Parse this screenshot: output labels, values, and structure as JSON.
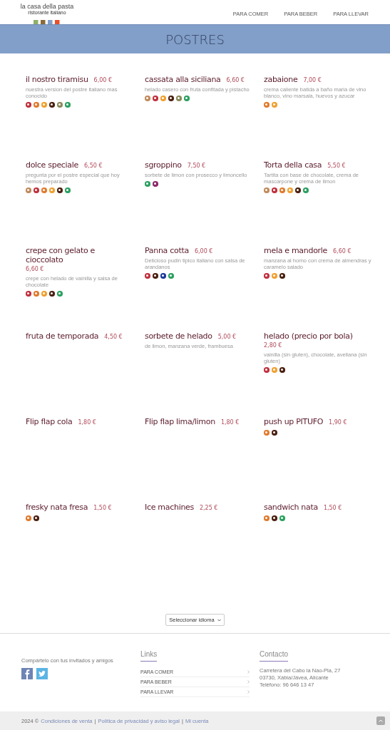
{
  "header": {
    "logo_title": "la casa della pasta",
    "logo_subtitle": "ristorante italiano",
    "nav": [
      {
        "label": "PARA COMER"
      },
      {
        "label": "PARA BEBER"
      },
      {
        "label": "PARA LLEVAR"
      }
    ]
  },
  "banner": {
    "title": "POSTRES"
  },
  "menu_items": [
    {
      "name": "il nostro tiramisu",
      "price": "6,00 €",
      "description": "nuestra version del postre italiano mas conocido",
      "allergens": [
        {
          "color": "#c0313e"
        },
        {
          "color": "#e07a2e"
        },
        {
          "color": "#f0a030"
        },
        {
          "color": "#4a2010"
        },
        {
          "color": "#8a8a5a"
        },
        {
          "color": "#2aa060"
        }
      ]
    },
    {
      "name": "cassata alla siciliana",
      "price": "6,60 €",
      "description": "helado casero con fruta confitada y pistacho",
      "allergens": [
        {
          "color": "#c08a5a"
        },
        {
          "color": "#c0313e"
        },
        {
          "color": "#f0a030"
        },
        {
          "color": "#4a2010"
        },
        {
          "color": "#8a8a5a"
        },
        {
          "color": "#2aa060"
        }
      ]
    },
    {
      "name": "zabaione",
      "price": "7,00 €",
      "description": "crema caliente batida a baño maria de vino blanco, vino marsala, huevos y azucar",
      "allergens": [
        {
          "color": "#e07a2e"
        },
        {
          "color": "#f0a030"
        }
      ]
    },
    {
      "name": "dolce speciale",
      "price": "6,50 €",
      "description": "pregunta por el postre especial que hoy hemos preparado",
      "allergens": [
        {
          "color": "#c08a5a"
        },
        {
          "color": "#c0313e"
        },
        {
          "color": "#e07a2e"
        },
        {
          "color": "#f0a030"
        },
        {
          "color": "#4a2010"
        },
        {
          "color": "#2aa060"
        }
      ]
    },
    {
      "name": "sgroppino",
      "price": "7,50 €",
      "description": "sorbete de limon con prosecco y limoncello",
      "allergens": [
        {
          "color": "#2aa060"
        },
        {
          "color": "#8a2a6a"
        }
      ]
    },
    {
      "name": "Torta della casa",
      "price": "5,50 €",
      "description": "Tartita con base de chocolate, crema de mascarpone y crema de limon",
      "allergens": [
        {
          "color": "#c08a5a"
        },
        {
          "color": "#c0313e"
        },
        {
          "color": "#e07a2e"
        },
        {
          "color": "#f0a030"
        },
        {
          "color": "#4a2010"
        },
        {
          "color": "#2aa060"
        }
      ]
    },
    {
      "name": "crepe con gelato e cioccolato",
      "price": "6,60 €",
      "description": "crepe con helado de vainilla y salsa de chocolate",
      "allergens": [
        {
          "color": "#c0313e"
        },
        {
          "color": "#e07a2e"
        },
        {
          "color": "#f0a030"
        },
        {
          "color": "#4a2010"
        },
        {
          "color": "#2aa060"
        }
      ]
    },
    {
      "name": "Panna cotta",
      "price": "6,00 €",
      "description": "Delicioso pudin tipico italiano con salsa de arandanos",
      "allergens": [
        {
          "color": "#c0313e"
        },
        {
          "color": "#4a2010"
        },
        {
          "color": "#1a3a9a"
        },
        {
          "color": "#2aa060"
        }
      ]
    },
    {
      "name": "mela e mandorle",
      "price": "6,60 €",
      "description": "manzana al horno con crema de almendras y caramelo salado",
      "allergens": [
        {
          "color": "#c0313e"
        },
        {
          "color": "#f0a030"
        },
        {
          "color": "#4a2010"
        }
      ]
    },
    {
      "name": "fruta de temporada",
      "price": "4,50 €"
    },
    {
      "name": "sorbete de helado",
      "price": "5,00 €",
      "description": "de limon, manzana verde, frambuesa"
    },
    {
      "name": "helado (precio por bola)",
      "price": "2,80 €",
      "description": "vainilla (sin gluten), chocolate, avellana (sin gluten)",
      "allergens": [
        {
          "color": "#c0313e"
        },
        {
          "color": "#f0a030"
        },
        {
          "color": "#4a2010"
        }
      ]
    },
    {
      "name": "Flip flap cola",
      "price": "1,80 €"
    },
    {
      "name": "Flip flap lima/limon",
      "price": "1,80 €"
    },
    {
      "name": "push up PITUFO",
      "price": "1,90 €",
      "allergens": [
        {
          "color": "#e07a2e"
        },
        {
          "color": "#4a2010"
        }
      ]
    },
    {
      "name": "fresky nata fresa",
      "price": "1,50 €",
      "allergens": [
        {
          "color": "#e07a2e"
        },
        {
          "color": "#4a2010"
        }
      ]
    },
    {
      "name": "Ice machines",
      "price": "2,25 €"
    },
    {
      "name": "sandwich nata",
      "price": "1,50 €",
      "allergens": [
        {
          "color": "#e07a2e"
        },
        {
          "color": "#4a2010"
        },
        {
          "color": "#2aa060"
        }
      ]
    }
  ],
  "language_select": {
    "value": "Seleccionar idioma"
  },
  "footer": {
    "share_text": "Compártelo con tus invitados y amigos",
    "links_title": "Links",
    "links": [
      {
        "label": "PARA COMER"
      },
      {
        "label": "PARA BEBER"
      },
      {
        "label": "PARA LLEVAR"
      }
    ],
    "contact_title": "Contacto",
    "contact_lines": [
      "Carretera del Cabo la Nao-Pla, 27",
      "03730, Xàbia/Jávea, Alicante",
      "Teléfono: 96 646 13 47"
    ]
  },
  "bottom_bar": {
    "copyright": "2024 ©",
    "links": [
      {
        "label": "Condiciones de venta"
      },
      {
        "label": "Política de privacidad y aviso legal"
      },
      {
        "label": "Mi cuenta"
      }
    ],
    "separator": "|"
  }
}
